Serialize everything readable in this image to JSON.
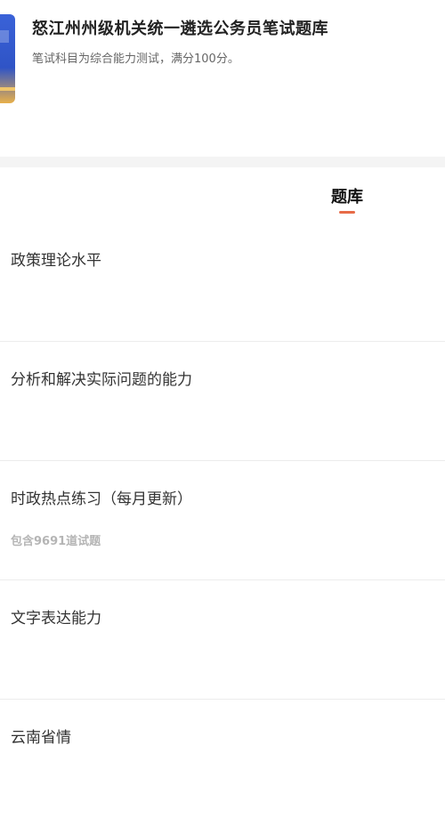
{
  "header": {
    "title": "怒江州州级机关统一遴选公务员笔试题库",
    "subtitle": "笔试科目为综合能力测试，满分100分。"
  },
  "tabs": [
    {
      "label": "题库",
      "active": true
    }
  ],
  "colors": {
    "accent": "#e76b47",
    "cover_blue": "#3a62d8",
    "background_gap": "#f4f4f4"
  },
  "question_bank": [
    {
      "title": "政策理论水平",
      "subtitle": ""
    },
    {
      "title": "分析和解决实际问题的能力",
      "subtitle": ""
    },
    {
      "title": "时政热点练习（每月更新）",
      "subtitle": "包含9691道试题"
    },
    {
      "title": "文字表达能力",
      "subtitle": ""
    },
    {
      "title": "云南省情",
      "subtitle": ""
    }
  ]
}
